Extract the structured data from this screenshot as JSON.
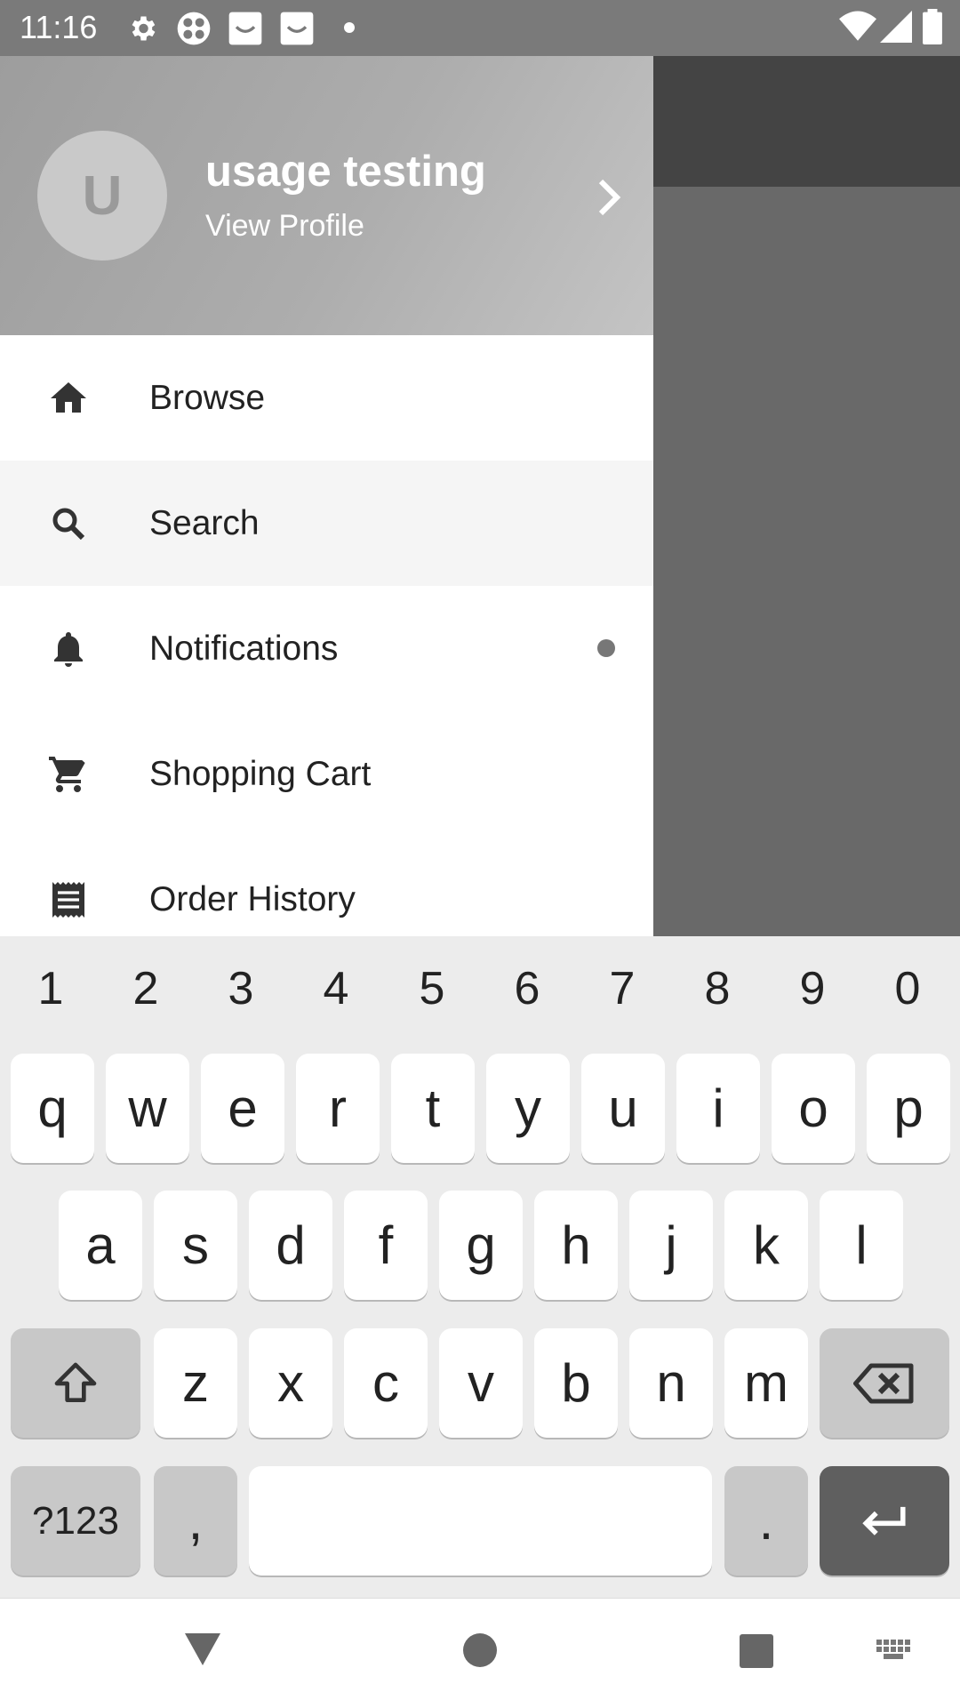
{
  "status_bar": {
    "time": "11:16",
    "icons": [
      "settings-icon",
      "app-grid-icon",
      "face-icon",
      "face-icon",
      "dot-icon",
      "wifi-icon",
      "signal-icon",
      "battery-icon"
    ]
  },
  "drawer": {
    "avatar_letter": "U",
    "user_name": "usage testing",
    "view_profile": "View Profile",
    "items": [
      {
        "label": "Browse",
        "icon": "home-icon"
      },
      {
        "label": "Search",
        "icon": "search-icon"
      },
      {
        "label": "Notifications",
        "icon": "bell-icon"
      },
      {
        "label": "Shopping Cart",
        "icon": "cart-icon"
      },
      {
        "label": "Order History",
        "icon": "receipt-icon"
      }
    ]
  },
  "keyboard": {
    "numbers": [
      "1",
      "2",
      "3",
      "4",
      "5",
      "6",
      "7",
      "8",
      "9",
      "0"
    ],
    "row1": [
      "q",
      "w",
      "e",
      "r",
      "t",
      "y",
      "u",
      "i",
      "o",
      "p"
    ],
    "row2": [
      "a",
      "s",
      "d",
      "f",
      "g",
      "h",
      "j",
      "k",
      "l"
    ],
    "row3": [
      "z",
      "x",
      "c",
      "v",
      "b",
      "n",
      "m"
    ],
    "symbols_label": "?123",
    "comma": ",",
    "period": "."
  },
  "colors": {
    "header_gradient_start": "#9d9d9d",
    "header_gradient_end": "#c4c4c4",
    "selected_item_bg": "#f5f5f5",
    "enter_key": "#5f5f5f"
  }
}
